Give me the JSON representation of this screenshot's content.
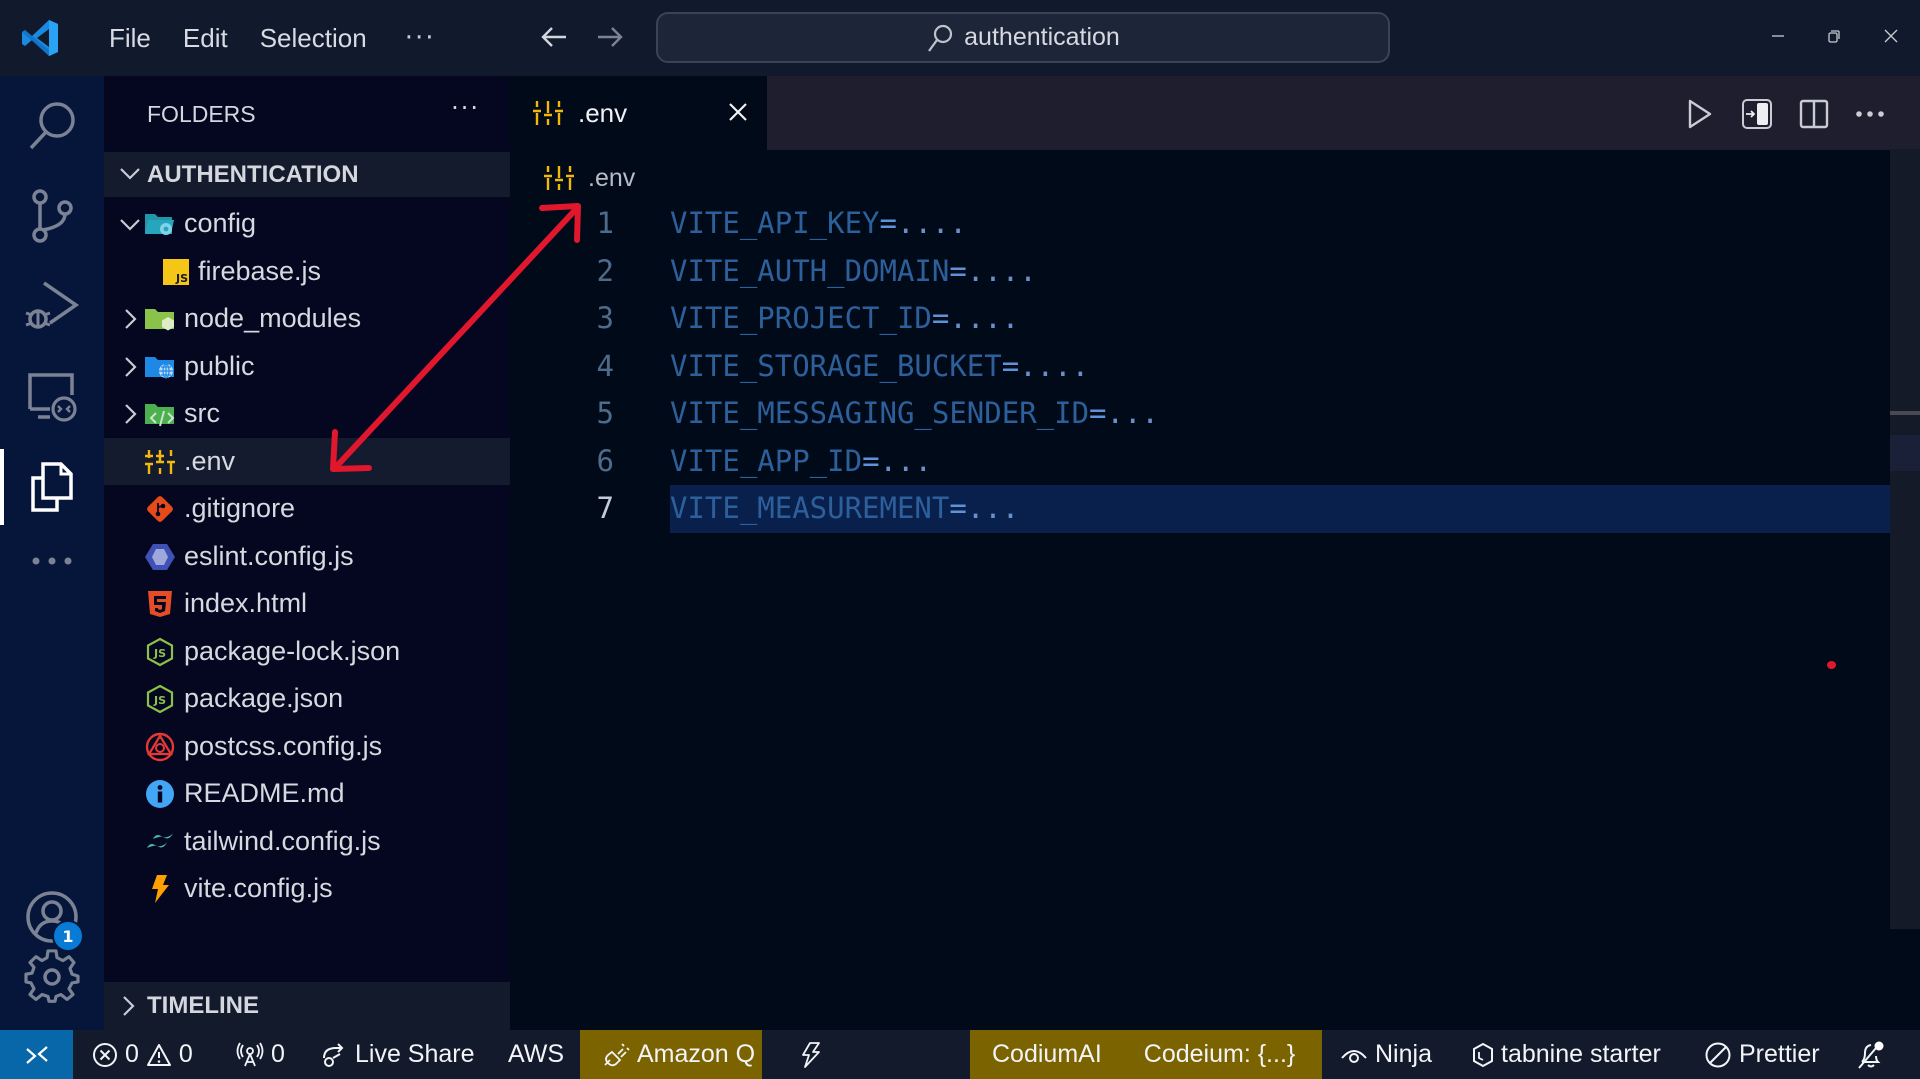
{
  "titlebar": {
    "menu": [
      "File",
      "Edit",
      "Selection"
    ],
    "more_label": "···",
    "search_text": "authentication",
    "back_icon": "arrow-left-icon",
    "forward_icon": "arrow-right-icon",
    "window_controls": {
      "minimize": "—",
      "restore": "❐",
      "close": "✕"
    }
  },
  "activitybar": {
    "items": [
      "search",
      "source-control",
      "run-and-debug",
      "remote-explorer",
      "explorer",
      "more"
    ],
    "active": "explorer",
    "accounts_badge": "1"
  },
  "sidebar": {
    "title": "FOLDERS",
    "more_label": "···",
    "section_title": "AUTHENTICATION",
    "tree": [
      {
        "label": "config",
        "type": "folder",
        "expanded": true,
        "depth": 1,
        "icon": "folder-config-icon"
      },
      {
        "label": "firebase.js",
        "type": "file",
        "depth": 2,
        "icon": "javascript-icon"
      },
      {
        "label": "node_modules",
        "type": "folder",
        "expanded": false,
        "depth": 1,
        "icon": "folder-node-icon"
      },
      {
        "label": "public",
        "type": "folder",
        "expanded": false,
        "depth": 1,
        "icon": "folder-public-icon"
      },
      {
        "label": "src",
        "type": "folder",
        "expanded": false,
        "depth": 1,
        "icon": "folder-src-icon"
      },
      {
        "label": ".env",
        "type": "file",
        "depth": 1,
        "icon": "env-settings-icon",
        "selected": true
      },
      {
        "label": ".gitignore",
        "type": "file",
        "depth": 1,
        "icon": "git-icon"
      },
      {
        "label": "eslint.config.js",
        "type": "file",
        "depth": 1,
        "icon": "eslint-icon"
      },
      {
        "label": "index.html",
        "type": "file",
        "depth": 1,
        "icon": "html5-icon"
      },
      {
        "label": "package-lock.json",
        "type": "file",
        "depth": 1,
        "icon": "nodejs-icon"
      },
      {
        "label": "package.json",
        "type": "file",
        "depth": 1,
        "icon": "nodejs-icon"
      },
      {
        "label": "postcss.config.js",
        "type": "file",
        "depth": 1,
        "icon": "postcss-icon"
      },
      {
        "label": "README.md",
        "type": "file",
        "depth": 1,
        "icon": "info-icon"
      },
      {
        "label": "tailwind.config.js",
        "type": "file",
        "depth": 1,
        "icon": "tailwind-icon"
      },
      {
        "label": "vite.config.js",
        "type": "file",
        "depth": 1,
        "icon": "vite-icon"
      }
    ],
    "timeline_title": "TIMELINE"
  },
  "editor": {
    "tab_label": ".env",
    "close_label": "✕",
    "breadcrumb": ".env",
    "current_line": 7,
    "lines": [
      {
        "n": "1",
        "key": "VITE_API_KEY",
        "eq": "=",
        "val": "...."
      },
      {
        "n": "2",
        "key": "VITE_AUTH_DOMAIN",
        "eq": "=",
        "val": "...."
      },
      {
        "n": "3",
        "key": "VITE_PROJECT_ID",
        "eq": "=",
        "val": "...."
      },
      {
        "n": "4",
        "key": "VITE_STORAGE_BUCKET",
        "eq": "=",
        "val": "...."
      },
      {
        "n": "5",
        "key": "VITE_MESSAGING_SENDER_ID",
        "eq": "=",
        "val": "..."
      },
      {
        "n": "6",
        "key": "VITE_APP_ID",
        "eq": "=",
        "val": "..."
      },
      {
        "n": "7",
        "key": "VITE_MEASUREMENT",
        "eq": "=",
        "val": "..."
      }
    ],
    "actions": [
      "run",
      "open-in-side",
      "split-editor",
      "more"
    ]
  },
  "statusbar": {
    "errors": "0",
    "warnings": "0",
    "ports": "0",
    "live_share": "Live Share",
    "aws": "AWS",
    "amazon_q": "Amazon Q",
    "codiumai": "CodiumAI",
    "codeium": "Codeium: {...}",
    "ninja": "Ninja",
    "tabnine": "tabnine starter",
    "prettier": "Prettier"
  },
  "colors": {
    "accent_remote": "#0767a8",
    "highlight_item": "#7b6300",
    "annotation_arrow": "#e0172d",
    "env_icon": "#f0b90b"
  }
}
